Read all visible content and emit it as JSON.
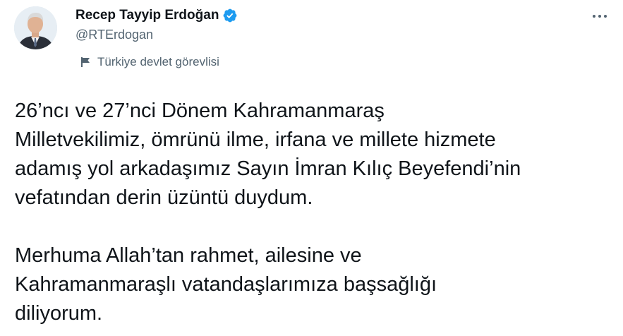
{
  "author": {
    "display_name": "Recep Tayyip Erdoğan",
    "handle": "@RTErdogan",
    "verified_icon": "verified-badge-icon",
    "label": "Türkiye devlet görevlisi",
    "label_icon": "flag-icon",
    "avatar": "avatar"
  },
  "more_icon": "more-options-icon",
  "tweet": {
    "paragraph1": [
      "26’ncı ve 27’nci Dönem Kahramanmaraş",
      "Milletvekilimiz, ömrünü ilme, irfana ve millete hizmete",
      "adamış yol arkadaşımız Sayın İmran Kılıç Beyefendi’nin",
      "vefatından derin üzüntü duydum."
    ],
    "paragraph2": [
      "Merhuma Allah’tan rahmet, ailesine ve",
      "Kahramanmaraşlı vatandaşlarımıza başsağlığı",
      "diliyorum."
    ]
  },
  "colors": {
    "text_primary": "#0f1419",
    "text_secondary": "#536471",
    "verified_blue": "#1d9bf0"
  }
}
